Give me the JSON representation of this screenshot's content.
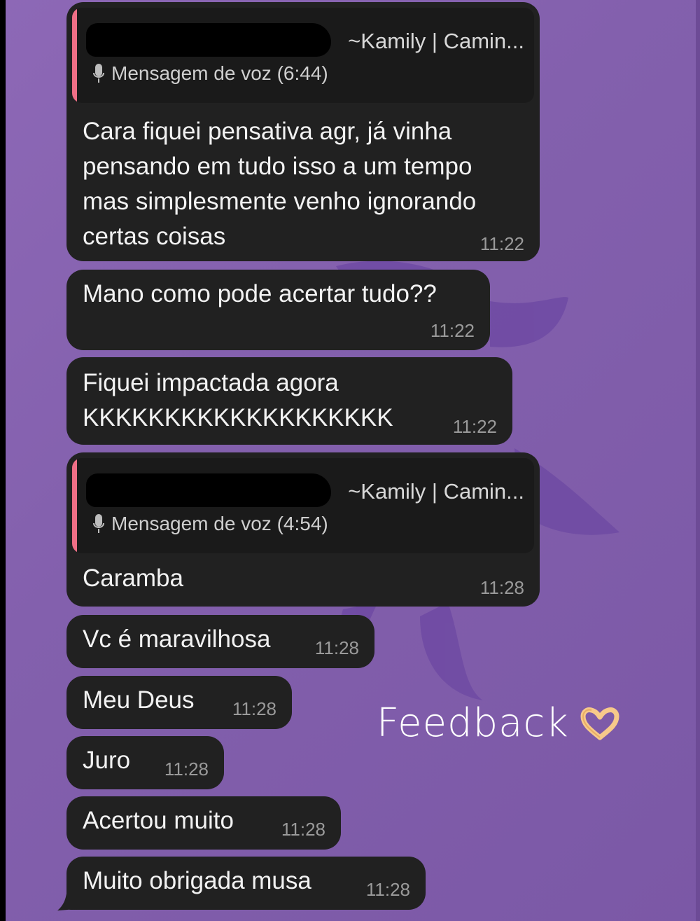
{
  "messages": [
    {
      "reply": {
        "name": "~Kamily | Camin...",
        "voice": "Mensagem de voz (6:44)"
      },
      "text": "Cara fiquei pensativa agr, já vinha\npensando em tudo isso a um tempo\nmas simplesmente venho ignorando\ncertas coisas",
      "time": "11:22"
    },
    {
      "text": "Mano como pode acertar tudo??",
      "time": "11:22"
    },
    {
      "text": "Fiquei impactada agora\nKKKKKKKKKKKKKKKKKKK",
      "time": "11:22"
    },
    {
      "reply": {
        "name": "~Kamily | Camin...",
        "voice": "Mensagem de voz (4:54)"
      },
      "text": "Caramba",
      "time": "11:28"
    },
    {
      "text": "Vc é maravilhosa",
      "time": "11:28"
    },
    {
      "text": "Meu Deus",
      "time": "11:28"
    },
    {
      "text": "Juro",
      "time": "11:28"
    },
    {
      "text": "Acertou muito",
      "time": "11:28"
    },
    {
      "text": "Muito obrigada musa",
      "time": "11:28"
    }
  ],
  "overlay": {
    "caption": "Feedback",
    "emoji_icon": "heart-hands-icon"
  },
  "colors": {
    "bubble": "#212121",
    "reply_accent": "#ef6f86",
    "background": "#8962b1"
  }
}
